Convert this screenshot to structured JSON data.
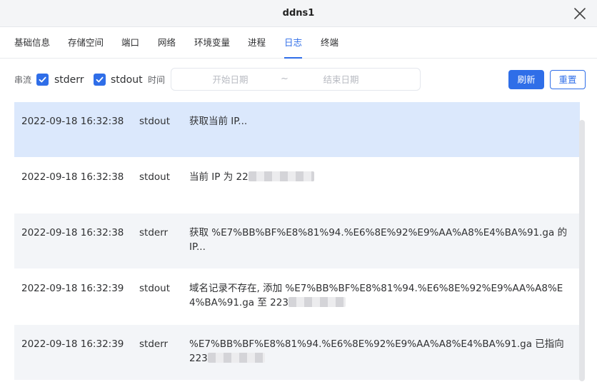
{
  "window": {
    "title": "ddns1"
  },
  "tabs": [
    {
      "label": "基础信息",
      "active": false
    },
    {
      "label": "存储空间",
      "active": false
    },
    {
      "label": "端口",
      "active": false
    },
    {
      "label": "网络",
      "active": false
    },
    {
      "label": "环境变量",
      "active": false
    },
    {
      "label": "进程",
      "active": false
    },
    {
      "label": "日志",
      "active": true
    },
    {
      "label": "终端",
      "active": false
    }
  ],
  "filters": {
    "stream_label": "串流",
    "stderr": {
      "label": "stderr",
      "checked": true
    },
    "stdout": {
      "label": "stdout",
      "checked": true
    },
    "time_label": "时间",
    "start_placeholder": "开始日期",
    "range_separator": "~",
    "end_placeholder": "结束日期"
  },
  "actions": {
    "refresh_label": "刷新",
    "reset_label": "重置"
  },
  "logs": [
    {
      "time": "2022-09-18 16:32:38",
      "stream": "stdout",
      "message": "获取当前 IP..."
    },
    {
      "time": "2022-09-18 16:32:38",
      "stream": "stdout",
      "message": "当前 IP 为 22"
    },
    {
      "time": "2022-09-18 16:32:38",
      "stream": "stderr",
      "message": "获取 %E7%BB%BF%E8%81%94.%E6%8E%92%E9%AA%A8%E4%BA%91.ga 的 IP..."
    },
    {
      "time": "2022-09-18 16:32:39",
      "stream": "stdout",
      "message": "域名记录不存在, 添加 %E7%BB%BF%E8%81%94.%E6%8E%92%E9%AA%A8%E4%BA%91.ga 至 223"
    },
    {
      "time": "2022-09-18 16:32:39",
      "stream": "stderr",
      "message": "%E7%BB%BF%E8%81%94.%E6%8E%92%E9%AA%A8%E4%BA%91.ga 已指向 223"
    }
  ],
  "colors": {
    "accent": "#2f6ee8",
    "selected_row": "#dbe8fc",
    "alt_row": "#f3f5f8"
  },
  "icons": {
    "close": "close-icon",
    "checkbox": "check-icon"
  }
}
